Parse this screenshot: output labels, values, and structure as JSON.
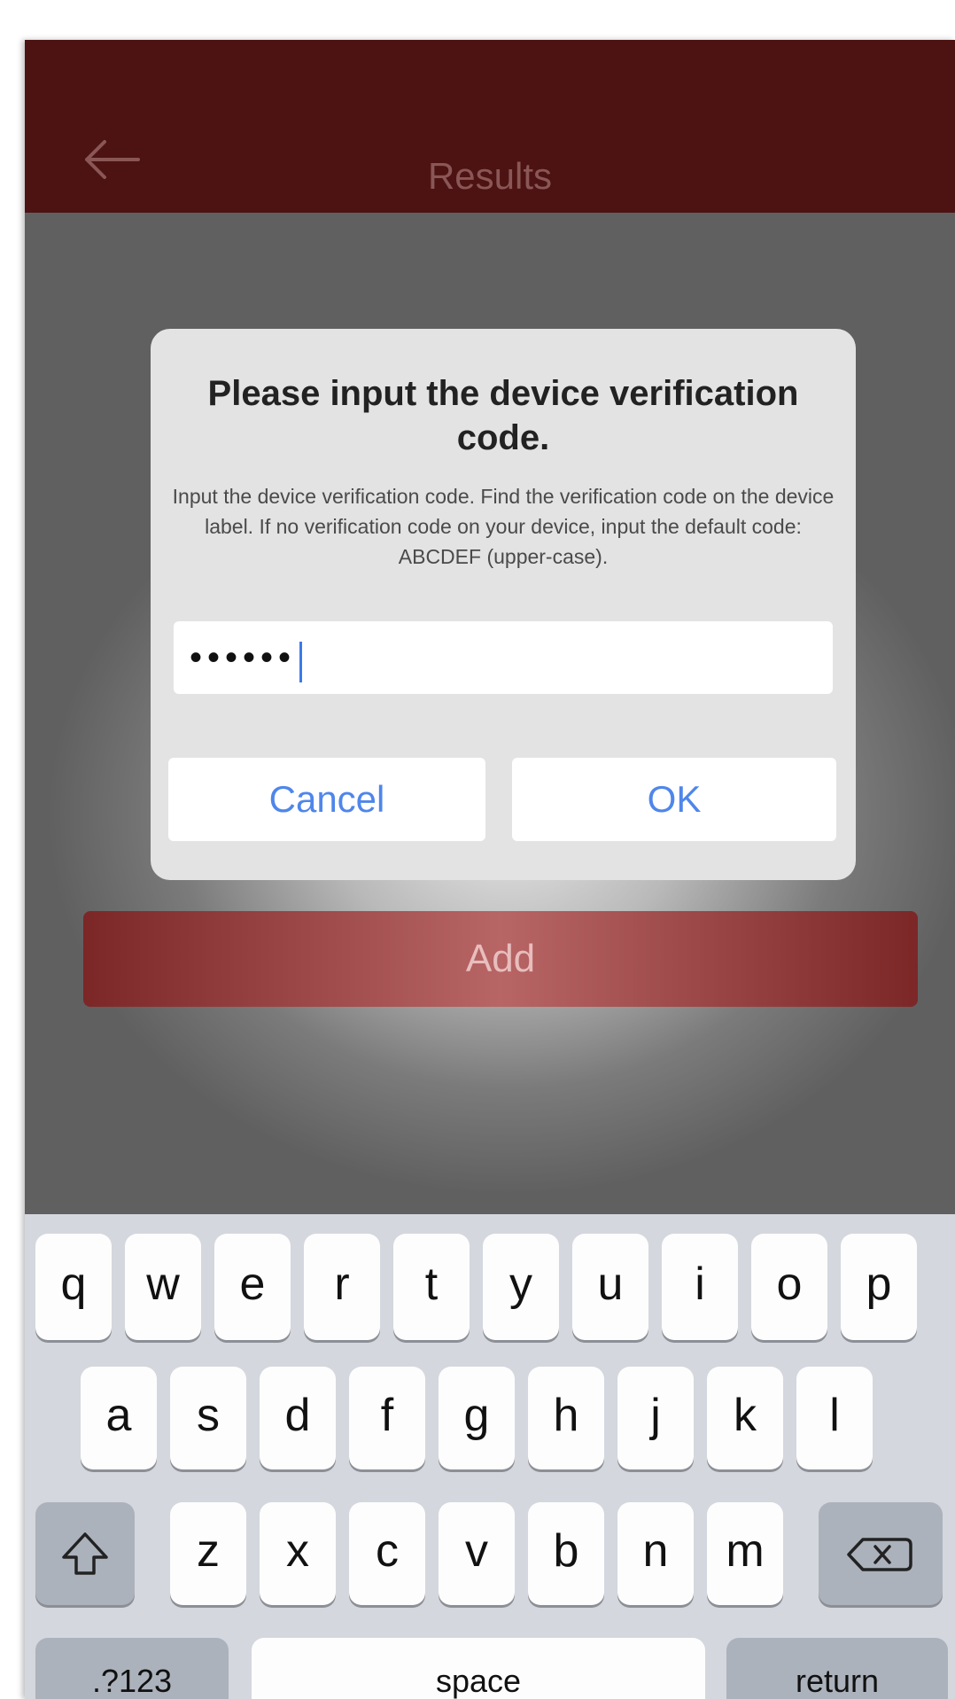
{
  "navbar": {
    "title": "Results",
    "back_icon": "arrow-left-icon"
  },
  "main": {
    "add_label": "Add"
  },
  "dialog": {
    "title": "Please input the device verification code.",
    "message": "Input the device verification code. Find the verification code on the device label. If no verification code on your device, input the default code: ABCDEF (upper-case).",
    "input_value": "••••••",
    "cancel_label": "Cancel",
    "ok_label": "OK"
  },
  "keyboard": {
    "row1": [
      "q",
      "w",
      "e",
      "r",
      "t",
      "y",
      "u",
      "i",
      "o",
      "p"
    ],
    "row2": [
      "a",
      "s",
      "d",
      "f",
      "g",
      "h",
      "j",
      "k",
      "l"
    ],
    "row3": [
      "z",
      "x",
      "c",
      "v",
      "b",
      "n",
      "m"
    ],
    "shift_icon": "shift-icon",
    "delete_icon": "backspace-icon",
    "numbers_label": ".?123",
    "space_label": "space",
    "return_label": "return"
  },
  "colors": {
    "navbar": "#4d1313",
    "accent_blue": "#4f86ea",
    "add_button": "#9a4040"
  }
}
